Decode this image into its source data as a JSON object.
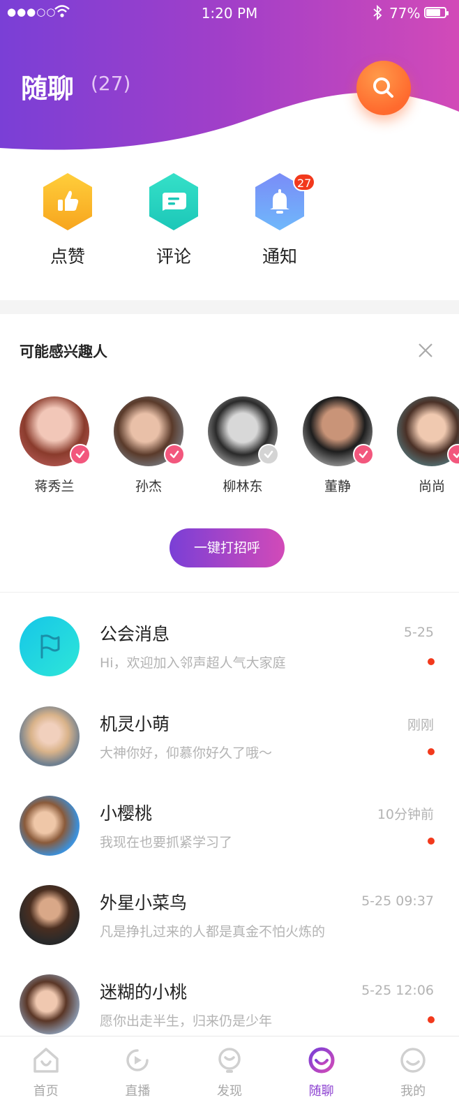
{
  "status_bar": {
    "time": "1:20 PM",
    "battery": "77%",
    "battery_level": 0.77
  },
  "header": {
    "title": "随聊",
    "count": "(27)"
  },
  "colors": {
    "brand_start": "#7a3fd6",
    "brand_end": "#d24ab8",
    "accent_orange": "#ff6a2e",
    "unread_red": "#f2391c"
  },
  "quick_actions": [
    {
      "label": "点赞",
      "icon": "thumbs-up-icon"
    },
    {
      "label": "评论",
      "icon": "comment-icon"
    },
    {
      "label": "通知",
      "icon": "bell-icon",
      "badge": "27"
    }
  ],
  "suggest": {
    "title": "可能感兴趣人",
    "people": [
      {
        "name": "蒋秀兰",
        "selected": true
      },
      {
        "name": "孙杰",
        "selected": true
      },
      {
        "name": "柳林东",
        "selected": false
      },
      {
        "name": "董静",
        "selected": true
      },
      {
        "name": "尚尚",
        "selected": true
      }
    ],
    "greet_button": "一键打招呼"
  },
  "messages": [
    {
      "name": "公会消息",
      "text": "Hi，欢迎加入邻声超人气大家庭",
      "time": "5-25",
      "unread": true
    },
    {
      "name": "机灵小萌",
      "text": "大神你好，仰慕你好久了哦～",
      "time": "刚刚",
      "unread": true
    },
    {
      "name": "小樱桃",
      "text": "我现在也要抓紧学习了",
      "time": "10分钟前",
      "unread": true
    },
    {
      "name": "外星小菜鸟",
      "text": "凡是挣扎过来的人都是真金不怕火炼的",
      "time": "5-25 09:37",
      "unread": false
    },
    {
      "name": "迷糊的小桃",
      "text": "愿你出走半生，归来仍是少年",
      "time": "5-25 12:06",
      "unread": true
    }
  ],
  "tabbar": [
    {
      "label": "首页",
      "icon": "home-icon"
    },
    {
      "label": "直播",
      "icon": "live-icon"
    },
    {
      "label": "发现",
      "icon": "discover-icon"
    },
    {
      "label": "随聊",
      "icon": "chat-icon",
      "active": true
    },
    {
      "label": "我的",
      "icon": "profile-icon"
    }
  ]
}
